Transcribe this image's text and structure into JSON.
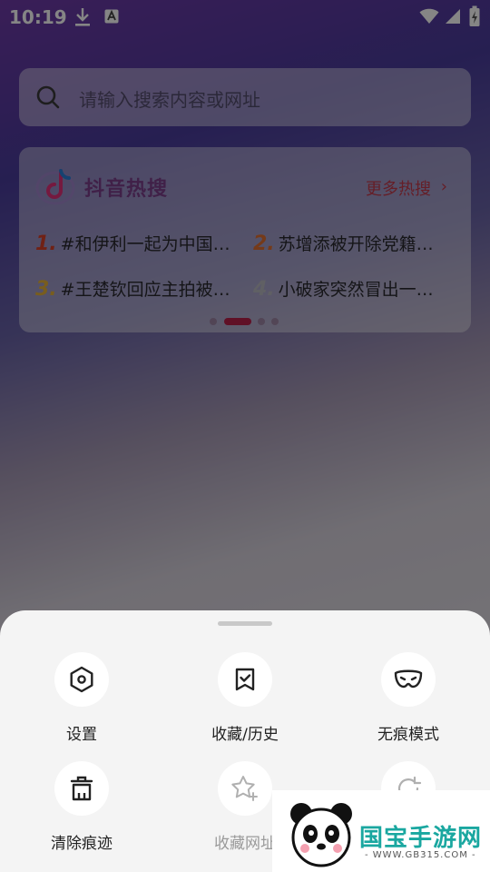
{
  "status_bar": {
    "time": "10:19"
  },
  "search": {
    "placeholder": "请输入搜索内容或网址"
  },
  "hot": {
    "title": "抖音热搜",
    "more": "更多热搜",
    "items": [
      {
        "rank": "1.",
        "text": "#和伊利一起为中国…",
        "rank_color": "#d6402a"
      },
      {
        "rank": "2.",
        "text": "苏增添被开除党籍…",
        "rank_color": "#e07030"
      },
      {
        "rank": "3.",
        "text": "#王楚钦回应主拍被…",
        "rank_color": "#e6b23a"
      },
      {
        "rank": "4.",
        "text": "小破家突然冒出一…",
        "rank_color": "#b8b8c0"
      }
    ]
  },
  "menu": {
    "items": [
      {
        "label": "设置",
        "icon": "settings-hexagon-icon"
      },
      {
        "label": "收藏/历史",
        "icon": "bookmark-check-icon"
      },
      {
        "label": "无痕模式",
        "icon": "mask-icon"
      },
      {
        "label": "清除痕迹",
        "icon": "trash-icon"
      },
      {
        "label": "收藏网址",
        "icon": "star-plus-icon"
      },
      {
        "label": "",
        "icon": "refresh-icon"
      }
    ]
  },
  "watermark": {
    "text": "国宝手游网",
    "url": "- WWW.GB315.COM -"
  },
  "colors": {
    "accent": "#b8204a",
    "more": "#c23a4c"
  }
}
